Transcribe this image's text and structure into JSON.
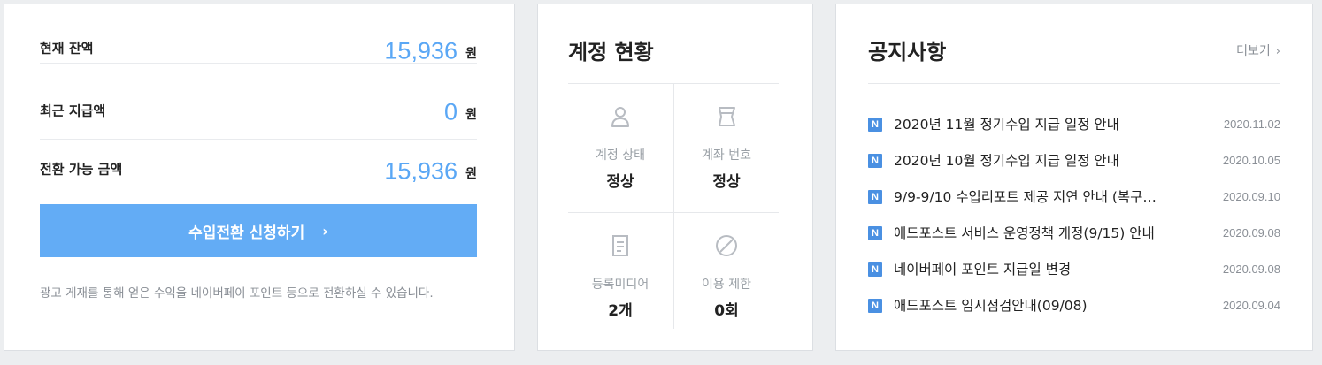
{
  "balance": {
    "rows": [
      {
        "label": "현재 잔액",
        "amount": "15,936",
        "unit": "원"
      },
      {
        "label": "최근 지급액",
        "amount": "0",
        "unit": "원"
      },
      {
        "label": "전환 가능 금액",
        "amount": "15,936",
        "unit": "원"
      }
    ],
    "button_label": "수입전환 신청하기",
    "description": "광고 게재를 통해 얻은 수익을 네이버페이 포인트 등으로 전환하실 수 있습니다."
  },
  "account": {
    "title": "계정 현황",
    "cells": [
      {
        "label": "계정 상태",
        "value": "정상",
        "icon": "user-icon"
      },
      {
        "label": "계좌 번호",
        "value": "정상",
        "icon": "card-icon"
      },
      {
        "label": "등록미디어",
        "value": "2개",
        "icon": "document-icon"
      },
      {
        "label": "이용 제한",
        "value": "0회",
        "icon": "prohibited-icon"
      }
    ]
  },
  "notice": {
    "title": "공지사항",
    "more_label": "더보기",
    "badge": "N",
    "items": [
      {
        "text": "2020년 11월 정기수입 지급 일정 안내",
        "date": "2020.11.02"
      },
      {
        "text": "2020년 10월 정기수입 지급 일정 안내",
        "date": "2020.10.05"
      },
      {
        "text": "9/9-9/10 수입리포트 제공 지연 안내 (복구…",
        "date": "2020.09.10"
      },
      {
        "text": "애드포스트 서비스 운영정책 개정(9/15) 안내",
        "date": "2020.09.08"
      },
      {
        "text": "네이버페이 포인트 지급일 변경",
        "date": "2020.09.08"
      },
      {
        "text": "애드포스트 임시점검안내(09/08)",
        "date": "2020.09.04"
      }
    ]
  },
  "colors": {
    "accent": "#63acf5",
    "amount": "#5aa7f5",
    "badge": "#4a90e2"
  }
}
